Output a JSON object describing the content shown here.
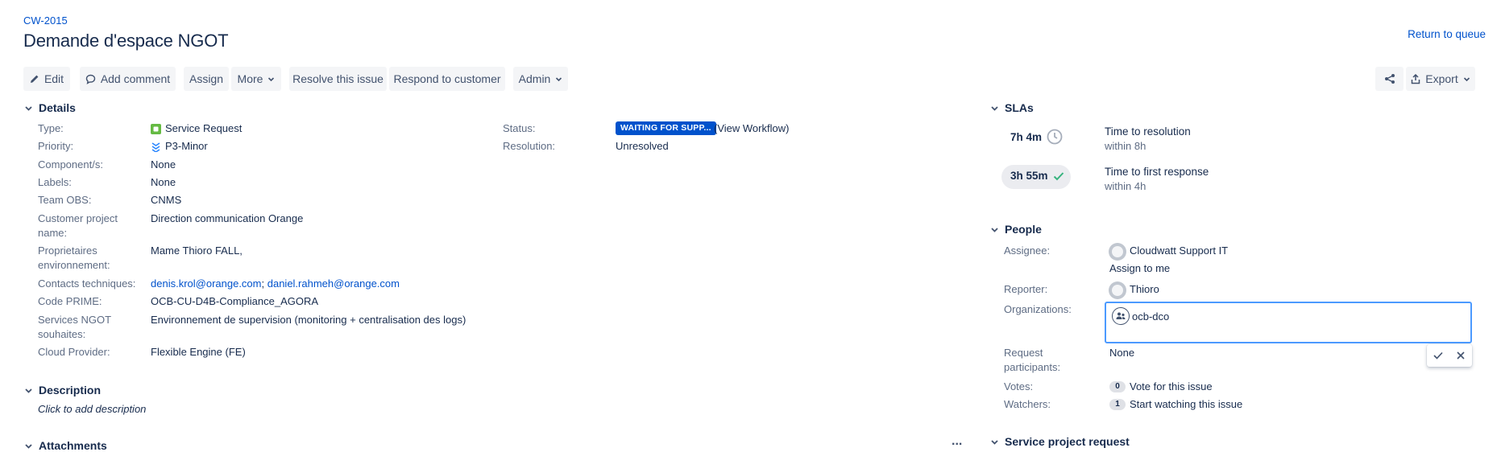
{
  "header": {
    "issue_key": "CW-2015",
    "title": "Demande d'espace NGOT",
    "return_link": "Return to queue"
  },
  "toolbar": {
    "edit": "Edit",
    "add_comment": "Add comment",
    "assign": "Assign",
    "more": "More",
    "resolve": "Resolve this issue",
    "respond": "Respond to customer",
    "admin": "Admin",
    "export": "Export"
  },
  "details": {
    "heading": "Details",
    "type_label": "Type:",
    "type_value": "Service Request",
    "priority_label": "Priority:",
    "priority_value": "P3-Minor",
    "components_label": "Component/s:",
    "components_value": "None",
    "labels_label": "Labels:",
    "labels_value": "None",
    "team_label": "Team OBS:",
    "team_value": "CNMS",
    "customer_project_label_1": "Customer project",
    "customer_project_label_2": "name:",
    "customer_project_value": "Direction communication Orange",
    "owners_label_1": "Proprietaires",
    "owners_label_2": "environnement:",
    "owners_value": "Mame Thioro FALL,",
    "contacts_label": "Contacts techniques:",
    "contact_1": "denis.krol@orange.com",
    "contact_sep": ";",
    "contact_2": "daniel.rahmeh@orange.com",
    "code_prime_label": "Code PRIME:",
    "code_prime_value": "OCB-CU-D4B-Compliance_AGORA",
    "services_label_1": "Services NGOT",
    "services_label_2": "souhaites:",
    "services_value": "Environnement de supervision (monitoring + centralisation des logs)",
    "cloud_label": "Cloud Provider:",
    "cloud_value": "Flexible Engine (FE)",
    "status_label": "Status:",
    "status_value": "WAITING FOR SUPP...",
    "view_workflow": "(View Workflow)",
    "resolution_label": "Resolution:",
    "resolution_value": "Unresolved"
  },
  "description": {
    "heading": "Description",
    "placeholder": "Click to add description"
  },
  "attachments": {
    "heading": "Attachments",
    "more": "..."
  },
  "slas": {
    "heading": "SLAs",
    "items": [
      {
        "time": "7h 4m",
        "title": "Time to resolution",
        "target": "within 8h"
      },
      {
        "time": "3h 55m",
        "title": "Time to first response",
        "target": "within 4h"
      }
    ]
  },
  "people": {
    "heading": "People",
    "assignee_label": "Assignee:",
    "assignee_value": "Cloudwatt Support IT",
    "assign_to_me": "Assign to me",
    "reporter_label": "Reporter:",
    "reporter_value": "Thioro",
    "organizations_label": "Organizations:",
    "organization_value": "ocb-dco",
    "participants_label_1": "Request",
    "participants_label_2": "participants:",
    "participants_value": "None",
    "votes_label": "Votes:",
    "votes_count": "0",
    "votes_link": "Vote for this issue",
    "watchers_label": "Watchers:",
    "watchers_count": "1",
    "watchers_link": "Start watching this issue"
  },
  "service_project": {
    "heading": "Service project request"
  },
  "colors": {
    "link": "#0052cc",
    "status_lozenge": "#0052cc",
    "sla_ok": "#36b37e",
    "service_request_icon": "#65ba43",
    "priority_icon": "#2684ff",
    "focus_border": "#4c9aff"
  }
}
